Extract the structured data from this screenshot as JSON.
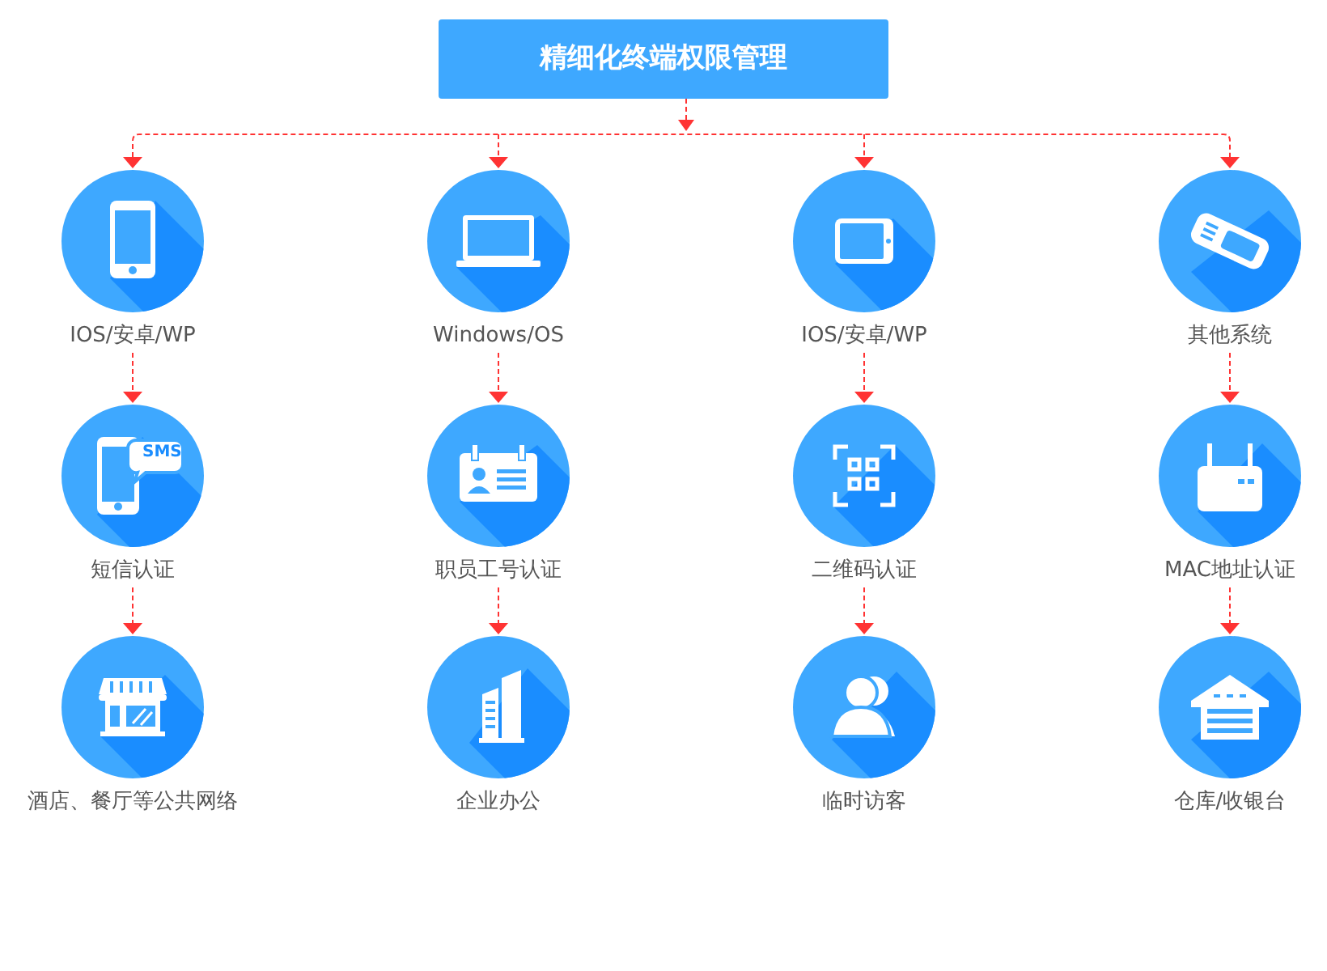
{
  "title": "精细化终端权限管理",
  "columns": [
    {
      "nodes": [
        {
          "label": "IOS/安卓/WP"
        },
        {
          "label": "短信认证",
          "icon_text": "SMS"
        },
        {
          "label": "酒店、餐厅等公共网络"
        }
      ]
    },
    {
      "nodes": [
        {
          "label": "Windows/OS"
        },
        {
          "label": "职员工号认证"
        },
        {
          "label": "企业办公"
        }
      ]
    },
    {
      "nodes": [
        {
          "label": "IOS/安卓/WP"
        },
        {
          "label": "二维码认证"
        },
        {
          "label": "临时访客"
        }
      ]
    },
    {
      "nodes": [
        {
          "label": "其他系统"
        },
        {
          "label": "MAC地址认证"
        },
        {
          "label": "仓库/收银台"
        }
      ]
    }
  ]
}
